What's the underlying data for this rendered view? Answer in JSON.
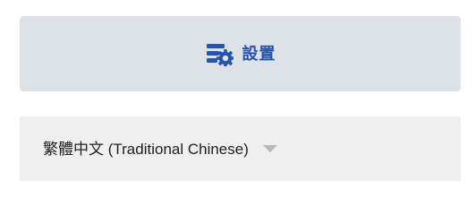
{
  "settings": {
    "label": "設置",
    "icon": "settings-list-gear-icon",
    "accent_color": "#2554a8",
    "background_color": "#dde1e8"
  },
  "language": {
    "selected": "繁體中文 (Traditional Chinese)",
    "icon": "caret-down-icon"
  }
}
